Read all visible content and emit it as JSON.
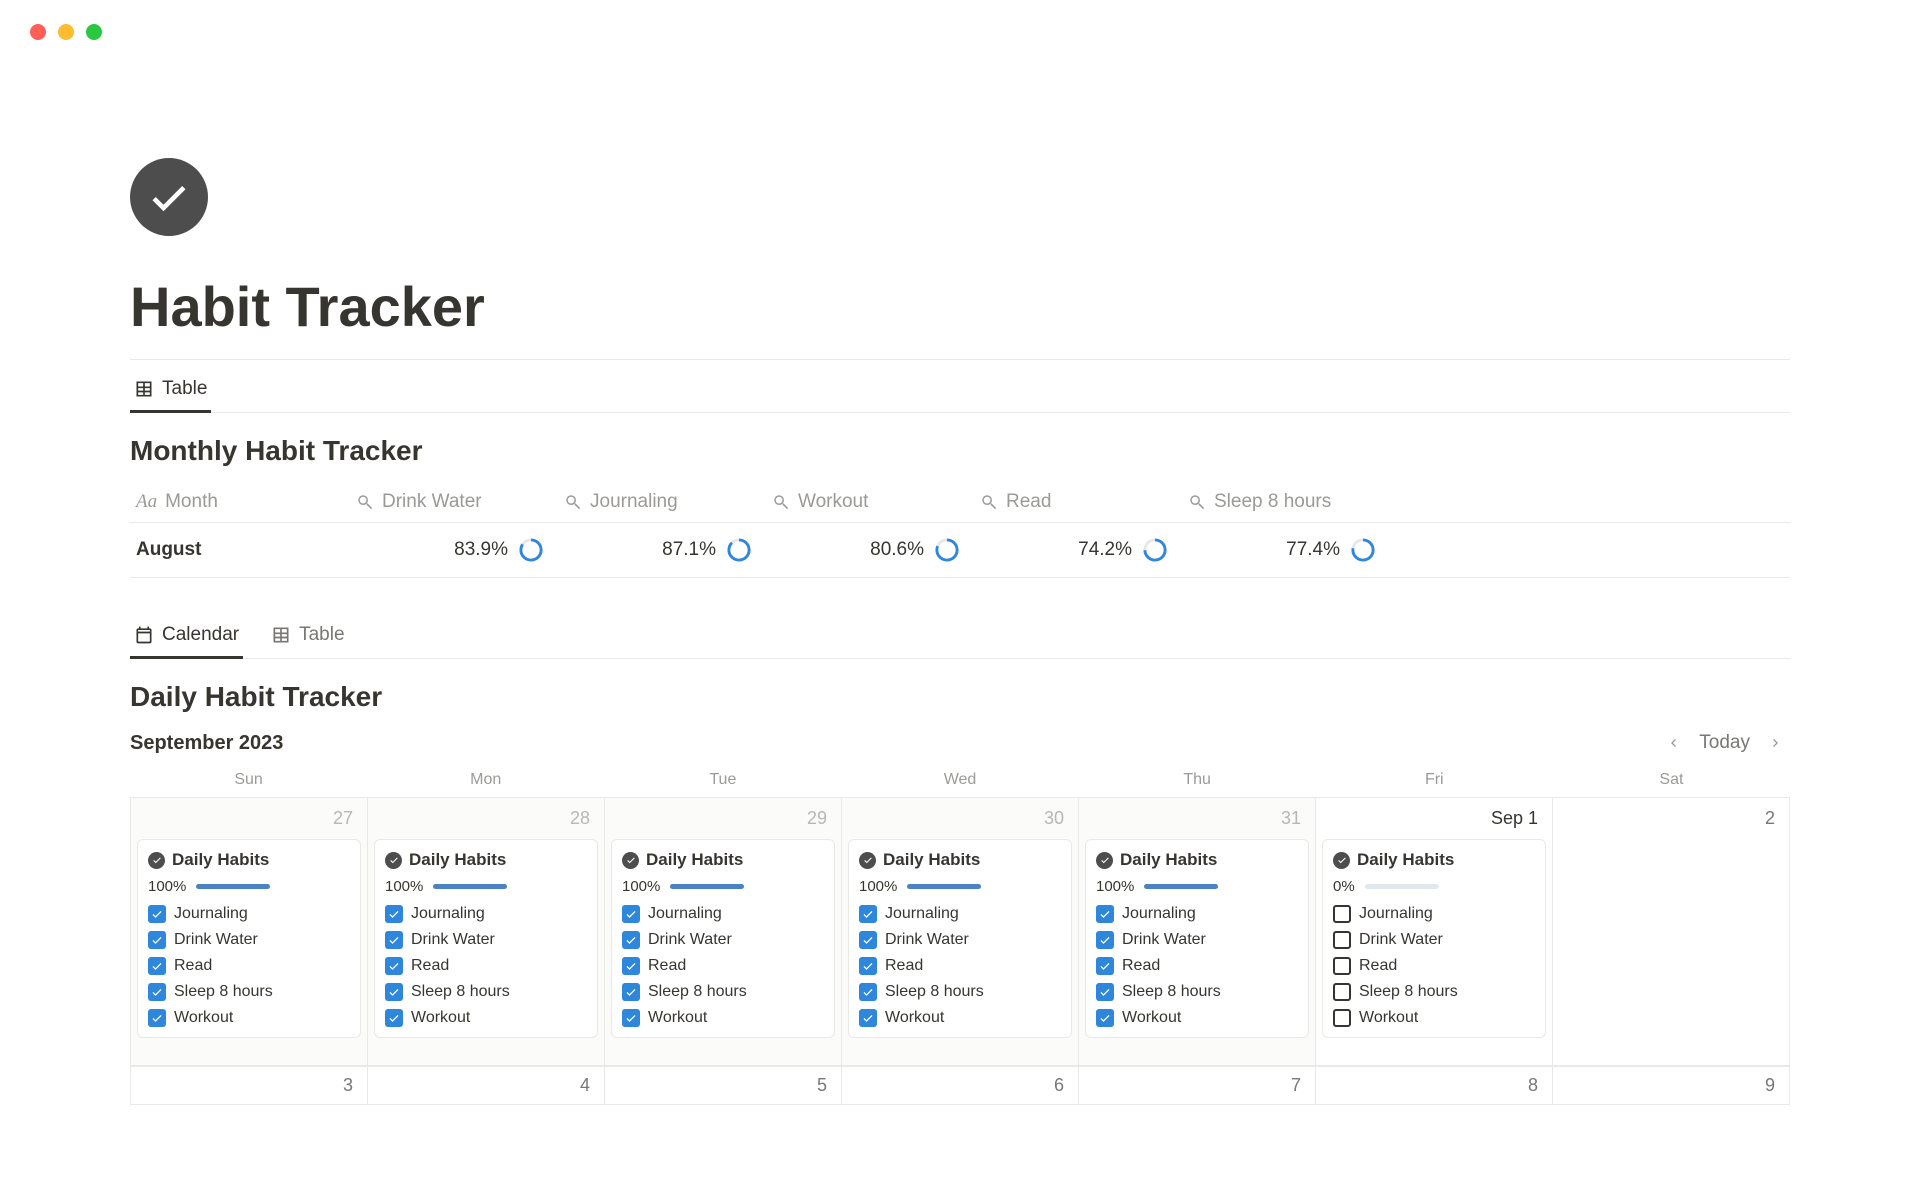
{
  "page_title": "Habit Tracker",
  "monthly": {
    "tab_label": "Table",
    "title": "Monthly Habit Tracker",
    "columns": [
      "Month",
      "Drink Water",
      "Journaling",
      "Workout",
      "Read",
      "Sleep 8 hours"
    ],
    "row": {
      "month": "August",
      "values": [
        "83.9%",
        "87.1%",
        "80.6%",
        "74.2%",
        "77.4%"
      ],
      "pct": [
        83.9,
        87.1,
        80.6,
        74.2,
        77.4
      ]
    }
  },
  "daily": {
    "tabs": {
      "calendar": "Calendar",
      "table": "Table"
    },
    "title": "Daily Habit Tracker",
    "month_label": "September 2023",
    "today_label": "Today",
    "weekdays": [
      "Sun",
      "Mon",
      "Tue",
      "Wed",
      "Thu",
      "Fri",
      "Sat"
    ],
    "row1_dates": [
      "27",
      "28",
      "29",
      "30",
      "31",
      "Sep 1",
      "2"
    ],
    "row2_dates": [
      "3",
      "4",
      "5",
      "6",
      "7",
      "8",
      "9"
    ],
    "card_title": "Daily Habits",
    "habits": [
      "Journaling",
      "Drink Water",
      "Read",
      "Sleep 8 hours",
      "Workout"
    ],
    "progress_full": "100%",
    "progress_zero": "0%"
  }
}
